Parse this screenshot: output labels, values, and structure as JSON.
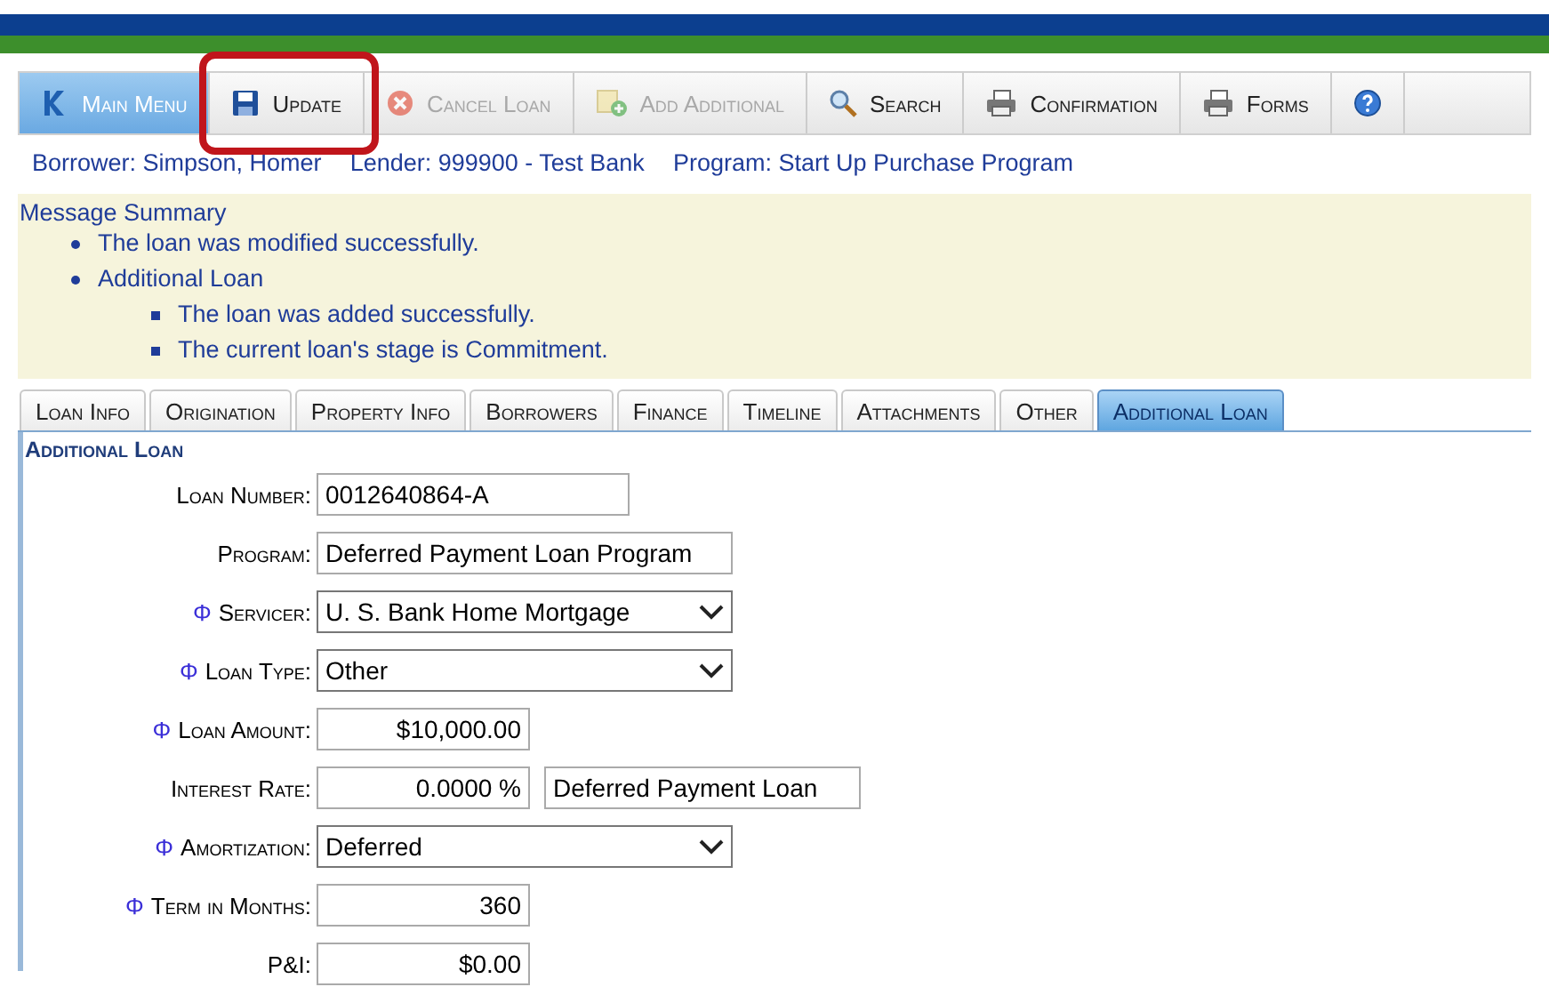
{
  "toolbar": {
    "items": [
      {
        "label": "Main Menu",
        "active": true,
        "disabled": false,
        "highlighted": false
      },
      {
        "label": "Update",
        "active": false,
        "disabled": false,
        "highlighted": true
      },
      {
        "label": "Cancel Loan",
        "active": false,
        "disabled": true,
        "highlighted": false
      },
      {
        "label": "Add Additional",
        "active": false,
        "disabled": true,
        "highlighted": false
      },
      {
        "label": "Search",
        "active": false,
        "disabled": false,
        "highlighted": false
      },
      {
        "label": "Confirmation",
        "active": false,
        "disabled": false,
        "highlighted": false
      },
      {
        "label": "Forms",
        "active": false,
        "disabled": false,
        "highlighted": false
      },
      {
        "active": false,
        "disabled": false,
        "highlighted": false
      }
    ]
  },
  "info_bar": [
    "Borrower: Simpson, Homer",
    "Lender: 999900 - Test Bank",
    "Program: Start Up Purchase Program"
  ],
  "message_summary": {
    "title": "Message Summary",
    "items": [
      {
        "text": "The loan was modified successfully."
      },
      {
        "text": "Additional Loan",
        "children": [
          {
            "text": "The loan was added successfully."
          },
          {
            "text": "The current loan's stage is Commitment."
          }
        ]
      }
    ]
  },
  "tabs": [
    {
      "label": "Loan Info",
      "selected": false
    },
    {
      "label": "Origination",
      "selected": false
    },
    {
      "label": "Property Info",
      "selected": false
    },
    {
      "label": "Borrowers",
      "selected": false
    },
    {
      "label": "Finance",
      "selected": false
    },
    {
      "label": "Timeline",
      "selected": false
    },
    {
      "label": "Attachments",
      "selected": false
    },
    {
      "label": "Other",
      "selected": false
    },
    {
      "label": "Additional Loan",
      "selected": true
    }
  ],
  "section_title": "Additional Loan",
  "fields": [
    {
      "label": "Loan Number:",
      "kind": "text",
      "value": "0012640864-A"
    },
    {
      "label": "Program:",
      "kind": "wide",
      "value": "Deferred Payment Loan Program"
    },
    {
      "label": "Servicer:",
      "marker": "Φ",
      "kind": "select",
      "value": "U. S. Bank Home Mortgage"
    },
    {
      "label": "Loan Type:",
      "marker": "Φ",
      "kind": "select",
      "value": "Other"
    },
    {
      "label": "Loan Amount:",
      "marker": "Φ",
      "kind": "number",
      "value": "$10,000.00"
    },
    {
      "label": "Interest Rate:",
      "kind": "number",
      "value": "0.0000 %",
      "note": "Deferred Payment Loan"
    },
    {
      "label": "Amortization:",
      "marker": "Φ",
      "kind": "select",
      "value": "Deferred"
    },
    {
      "label": "Term in Months:",
      "marker": "Φ",
      "kind": "number",
      "value": "360"
    },
    {
      "label": "P&I:",
      "kind": "number",
      "value": "$0.00"
    }
  ]
}
